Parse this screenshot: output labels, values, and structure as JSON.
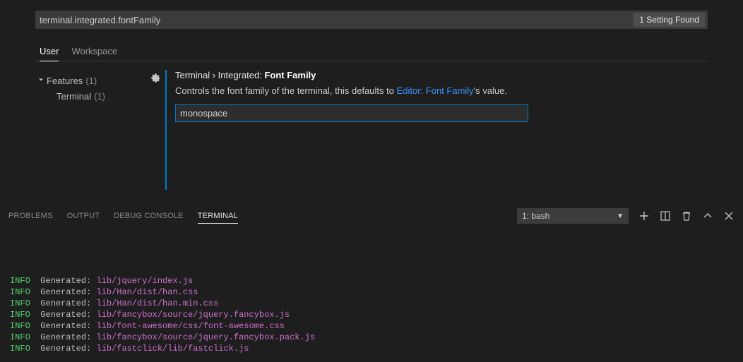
{
  "search": {
    "value": "terminal.integrated.fontFamily",
    "found_label": "1 Setting Found"
  },
  "scope_tabs": {
    "user": "User",
    "workspace": "Workspace"
  },
  "outline": {
    "features_label": "Features",
    "features_count": "(1)",
    "terminal_label": "Terminal",
    "terminal_count": "(1)"
  },
  "setting": {
    "breadcrumb": "Terminal › Integrated: ",
    "name": "Font Family",
    "desc_prefix": "Controls the font family of the terminal, this defaults to ",
    "desc_link": "Editor: Font Family",
    "desc_suffix": "'s value.",
    "value": "monospace"
  },
  "panel": {
    "tabs": {
      "problems": "Problems",
      "output": "Output",
      "debug": "Debug Console",
      "terminal": "Terminal"
    },
    "select": "1: bash",
    "logs": [
      {
        "level": "INFO",
        "mid": "  Generated: ",
        "path": "lib/jquery/index.js"
      },
      {
        "level": "INFO",
        "mid": "  Generated: ",
        "path": "lib/Han/dist/han.css"
      },
      {
        "level": "INFO",
        "mid": "  Generated: ",
        "path": "lib/Han/dist/han.min.css"
      },
      {
        "level": "INFO",
        "mid": "  Generated: ",
        "path": "lib/fancybox/source/jquery.fancybox.js"
      },
      {
        "level": "INFO",
        "mid": "  Generated: ",
        "path": "lib/font-awesome/css/font-awesome.css"
      },
      {
        "level": "INFO",
        "mid": "  Generated: ",
        "path": "lib/fancybox/source/jquery.fancybox.pack.js"
      },
      {
        "level": "INFO",
        "mid": "  Generated: ",
        "path": "lib/fastclick/lib/fastclick.js"
      }
    ]
  }
}
